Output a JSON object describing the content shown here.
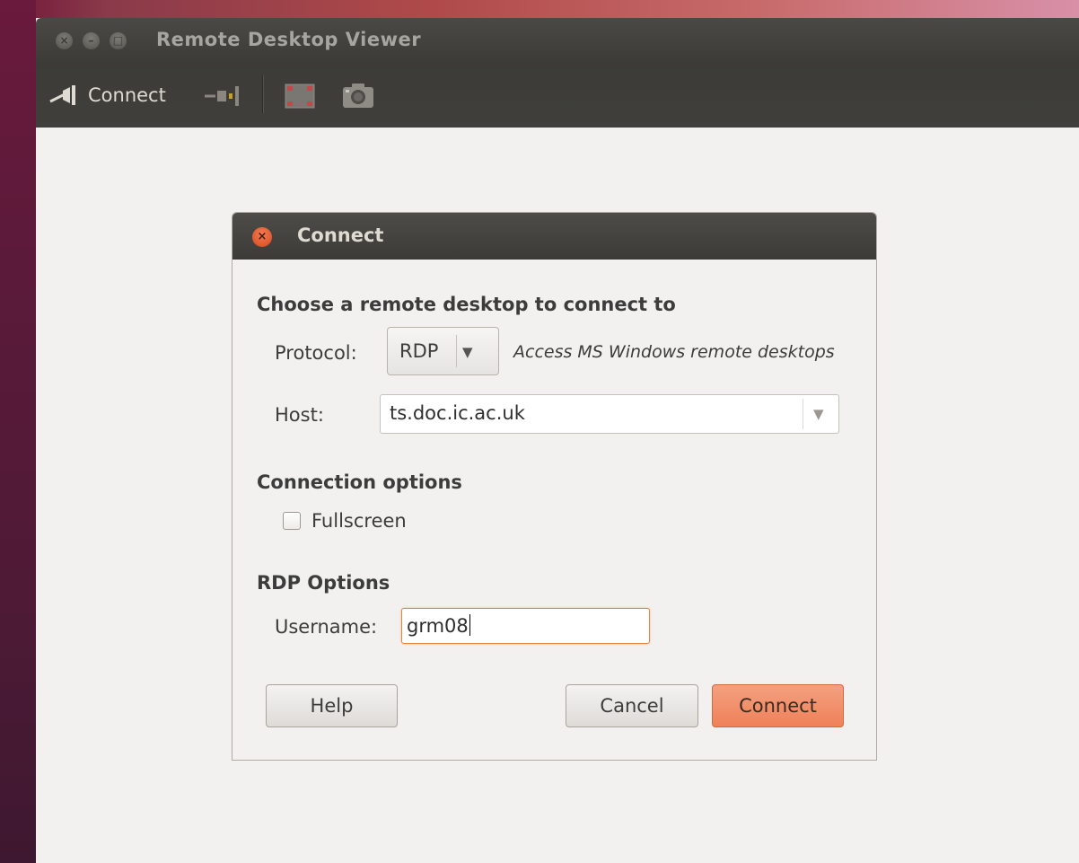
{
  "window": {
    "title": "Remote Desktop Viewer",
    "controls": [
      "close",
      "minimize",
      "maximize"
    ]
  },
  "toolbar": {
    "connect_label": "Connect",
    "icons": [
      "connect-icon",
      "disconnect-icon",
      "fullscreen-icon",
      "screenshot-icon"
    ]
  },
  "dialog": {
    "title": "Connect",
    "heading_choose": "Choose a remote desktop to connect to",
    "protocol_label": "Protocol:",
    "protocol_value": "RDP",
    "protocol_hint": "Access MS Windows remote desktops",
    "host_label": "Host:",
    "host_value": "ts.doc.ic.ac.uk",
    "connection_options_heading": "Connection options",
    "fullscreen_label": "Fullscreen",
    "fullscreen_checked": false,
    "rdp_options_heading": "RDP Options",
    "username_label": "Username:",
    "username_value": "grm08",
    "help_label": "Help",
    "cancel_label": "Cancel",
    "connect_label": "Connect"
  },
  "colors": {
    "accent": "#ef8159",
    "titlebar": "#3c3b37",
    "focus_border": "#e9833f"
  }
}
